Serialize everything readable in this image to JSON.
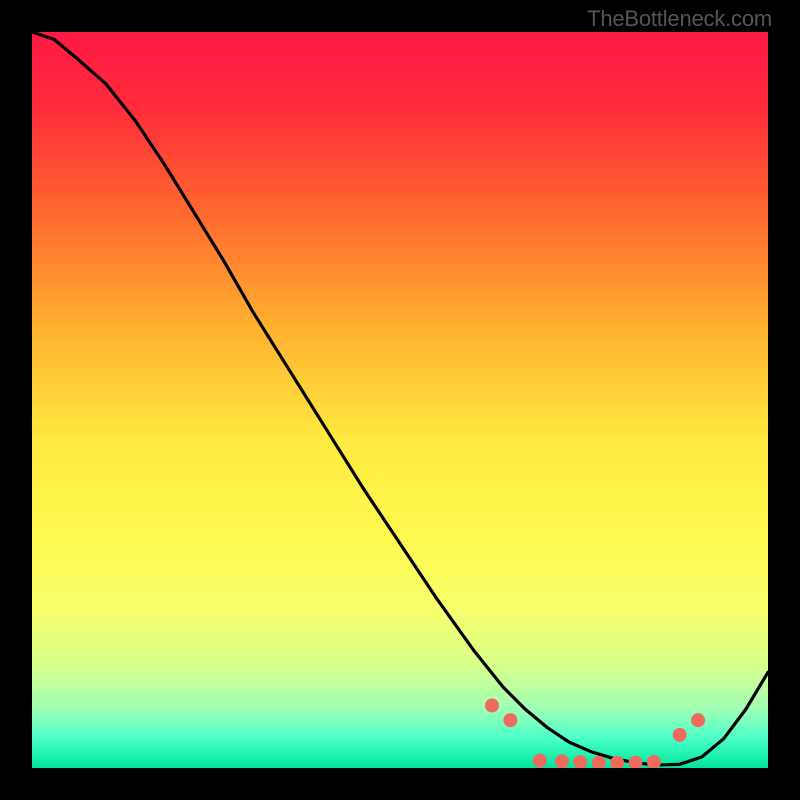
{
  "watermark": "TheBottleneck.com",
  "chart_data": {
    "type": "line",
    "title": "",
    "xlabel": "",
    "ylabel": "",
    "xlim": [
      0,
      100
    ],
    "ylim": [
      0,
      100
    ],
    "background_gradient": {
      "stops": [
        {
          "offset": 0.0,
          "color": "#ff1a44"
        },
        {
          "offset": 0.1,
          "color": "#ff2a3a"
        },
        {
          "offset": 0.25,
          "color": "#ff6a2f"
        },
        {
          "offset": 0.4,
          "color": "#ffb02f"
        },
        {
          "offset": 0.55,
          "color": "#ffe83f"
        },
        {
          "offset": 0.68,
          "color": "#fff94f"
        },
        {
          "offset": 0.78,
          "color": "#f9ff6a"
        },
        {
          "offset": 0.86,
          "color": "#d8ff8a"
        },
        {
          "offset": 0.92,
          "color": "#9fffb5"
        },
        {
          "offset": 0.96,
          "color": "#4affc8"
        },
        {
          "offset": 1.0,
          "color": "#00e59a"
        }
      ]
    },
    "series": [
      {
        "name": "curve",
        "color": "#000000",
        "x": [
          0,
          3,
          6,
          10,
          14,
          18,
          22,
          26,
          30,
          35,
          40,
          45,
          50,
          55,
          60,
          64,
          67,
          70,
          73,
          76,
          79,
          82,
          85,
          88,
          91,
          94,
          97,
          100
        ],
        "y": [
          100,
          99,
          96.5,
          93,
          88,
          82,
          75.5,
          69,
          62,
          54,
          46,
          38,
          30.5,
          23,
          16,
          11,
          8,
          5.5,
          3.5,
          2.2,
          1.3,
          0.7,
          0.4,
          0.5,
          1.5,
          4,
          8,
          13
        ]
      }
    ],
    "markers": {
      "name": "dots",
      "color": "#ee6a5f",
      "radius": 7,
      "x": [
        62.5,
        65,
        69,
        72,
        74.5,
        77,
        79.5,
        82,
        84.5,
        88,
        90.5
      ],
      "y": [
        8.5,
        6.5,
        1.0,
        0.9,
        0.8,
        0.7,
        0.7,
        0.7,
        0.8,
        4.5,
        6.5
      ]
    }
  }
}
